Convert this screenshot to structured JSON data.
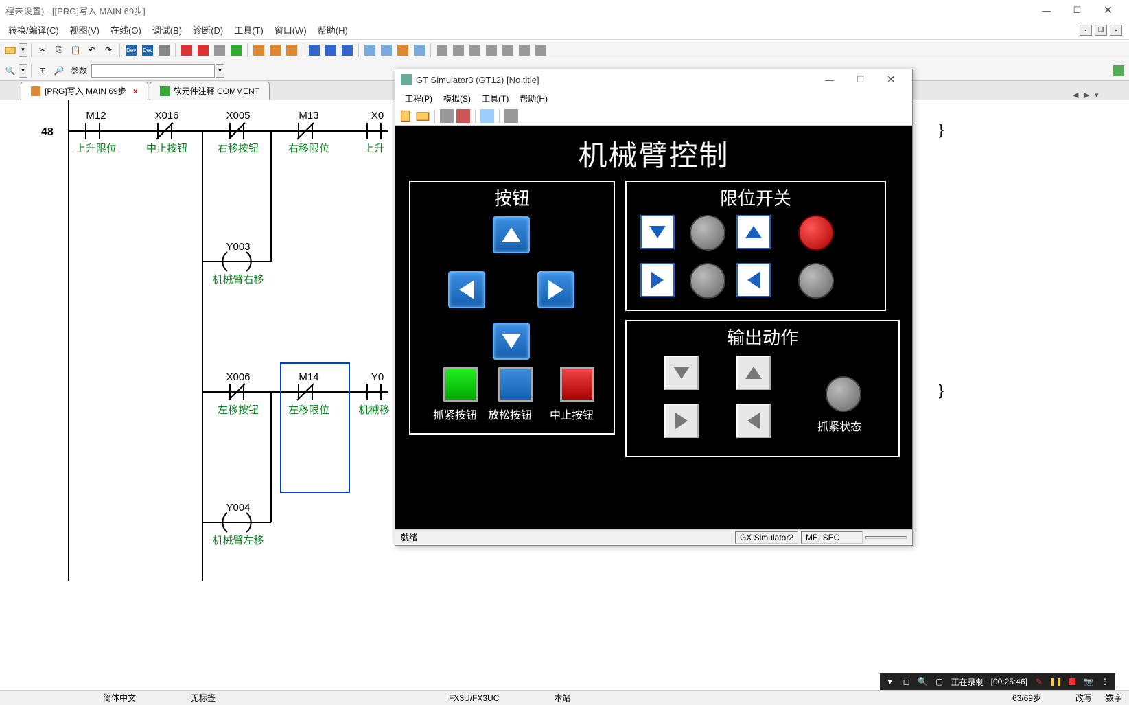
{
  "main": {
    "title": "程未设置) - [[PRG]写入 MAIN 69步]",
    "menus": [
      "转换/编译(C)",
      "视图(V)",
      "在线(O)",
      "调试(B)",
      "诊断(D)",
      "工具(T)",
      "窗口(W)",
      "帮助(H)"
    ],
    "toolbar2_label": "参数",
    "tabs": [
      {
        "label": "[PRG]写入 MAIN 69步",
        "active": true
      },
      {
        "label": "软元件注释 COMMENT",
        "active": false
      }
    ]
  },
  "ladder": {
    "rung_num": "48",
    "row1": [
      {
        "dev": "M12",
        "comment": "上升限位",
        "type": "no"
      },
      {
        "dev": "X016",
        "comment": "中止按钮",
        "type": "nc"
      },
      {
        "dev": "X005",
        "comment": "右移按钮",
        "type": "nc"
      },
      {
        "dev": "M13",
        "comment": "右移限位",
        "type": "nc"
      },
      {
        "dev": "X0",
        "comment": "上升",
        "type": "no"
      }
    ],
    "coil1": {
      "dev": "Y003",
      "comment": "机械臂右移"
    },
    "row2": [
      {
        "dev": "X006",
        "comment": "左移按钮",
        "type": "nc"
      },
      {
        "dev": "M14",
        "comment": "左移限位",
        "type": "nc",
        "selected": true
      },
      {
        "dev": "Y0",
        "comment": "机械移",
        "type": "no"
      }
    ],
    "coil2": {
      "dev": "Y004",
      "comment": "机械臂左移"
    }
  },
  "gt": {
    "title": "GT Simulator3 (GT12)   [No title]",
    "menus": [
      "工程(P)",
      "模拟(S)",
      "工具(T)",
      "帮助(H)"
    ],
    "status_ready": "就绪",
    "status_sim": "GX Simulator2",
    "status_plc": "MELSEC",
    "hmi": {
      "title": "机械臂控制",
      "panel_buttons": "按钮",
      "panel_limits": "限位开关",
      "panel_outputs": "输出动作",
      "grip_btn": "抓紧按钮",
      "release_btn": "放松按钮",
      "stop_btn": "中止按钮",
      "grip_status": "抓紧状态"
    }
  },
  "statusbar": {
    "lang": "简体中文",
    "tag": "无标签",
    "plc": "FX3U/FX3UC",
    "station": "本站",
    "step": "63/69步",
    "mode": "改写",
    "num": "数字"
  },
  "recorder": {
    "text": "正在录制",
    "time": "[00:25:46]"
  }
}
